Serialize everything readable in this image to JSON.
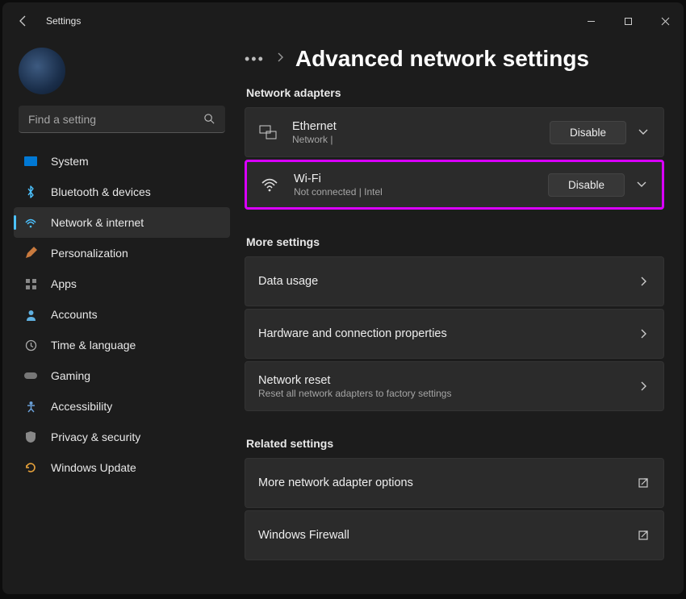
{
  "titlebar": {
    "title": "Settings"
  },
  "search": {
    "placeholder": "Find a setting"
  },
  "sidebar": {
    "items": [
      {
        "label": "System"
      },
      {
        "label": "Bluetooth & devices"
      },
      {
        "label": "Network & internet"
      },
      {
        "label": "Personalization"
      },
      {
        "label": "Apps"
      },
      {
        "label": "Accounts"
      },
      {
        "label": "Time & language"
      },
      {
        "label": "Gaming"
      },
      {
        "label": "Accessibility"
      },
      {
        "label": "Privacy & security"
      },
      {
        "label": "Windows Update"
      }
    ]
  },
  "page": {
    "title": "Advanced network settings"
  },
  "sections": {
    "adapters": {
      "label": "Network adapters",
      "items": [
        {
          "title": "Ethernet",
          "sub": "Network |",
          "action": "Disable"
        },
        {
          "title": "Wi-Fi",
          "sub": "Not connected | Intel",
          "action": "Disable"
        }
      ]
    },
    "more": {
      "label": "More settings",
      "items": [
        {
          "title": "Data usage",
          "sub": ""
        },
        {
          "title": "Hardware and connection properties",
          "sub": ""
        },
        {
          "title": "Network reset",
          "sub": "Reset all network adapters to factory settings"
        }
      ]
    },
    "related": {
      "label": "Related settings",
      "items": [
        {
          "title": "More network adapter options"
        },
        {
          "title": "Windows Firewall"
        }
      ]
    }
  }
}
